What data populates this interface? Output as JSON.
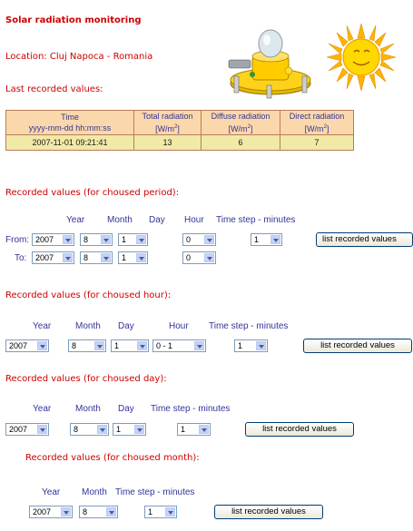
{
  "page": {
    "title": "Solar radiation monitoring",
    "location": "Location: Cluj Napoca - Romania",
    "last_heading": "Last recorded values:"
  },
  "last_values": {
    "headers": [
      {
        "line1": "Time",
        "line2": "yyyy-mm-dd hh:mm:ss",
        "sup": ""
      },
      {
        "line1": "Total radiation",
        "line2": "[W/m",
        "sup": "2"
      },
      {
        "line1": "Diffuse radiation",
        "line2": "[W/m",
        "sup": "2"
      },
      {
        "line1": "Direct radiation",
        "line2": "[W/m",
        "sup": "2"
      }
    ],
    "row": {
      "time": "2007-11-01 09:21:41",
      "total": "13",
      "diffuse": "6",
      "direct": "7"
    }
  },
  "period": {
    "heading": "Recorded values (for choused period):",
    "labels": {
      "year": "Year",
      "month": "Month",
      "day": "Day",
      "hour": "Hour",
      "step": "Time step - minutes",
      "from": "From:",
      "to": "To:"
    },
    "from": {
      "year": "2007",
      "month": "8",
      "day": "1",
      "hour": "0"
    },
    "to": {
      "year": "2007",
      "month": "8",
      "day": "1",
      "hour": "0"
    },
    "step": "1",
    "button": "list recorded values"
  },
  "hour_section": {
    "heading": "Recorded values (for choused hour):",
    "labels": {
      "year": "Year",
      "month": "Month",
      "day": "Day",
      "hour": "Hour",
      "step": "Time step - minutes"
    },
    "year": "2007",
    "month": "8",
    "day": "1",
    "hour": "0 - 1",
    "step": "1",
    "button": "list recorded values"
  },
  "day_section": {
    "heading": "Recorded values (for choused day):",
    "labels": {
      "year": "Year",
      "month": "Month",
      "day": "Day",
      "step": "Time step - minutes"
    },
    "year": "2007",
    "month": "8",
    "day": "1",
    "step": "1",
    "button": "list recorded values"
  },
  "month_section": {
    "heading": "Recorded values (for choused month):",
    "labels": {
      "year": "Year",
      "month": "Month",
      "step": "Time step - minutes"
    },
    "year": "2007",
    "month": "8",
    "step": "1",
    "button": "list recorded values"
  },
  "colors": {
    "heading": "#cc0000",
    "label": "#333399",
    "table_header_bg": "#fbd8ab",
    "table_row_bg": "#f1e9a6"
  },
  "icons": [
    "pyranometer-image",
    "sun-image"
  ]
}
